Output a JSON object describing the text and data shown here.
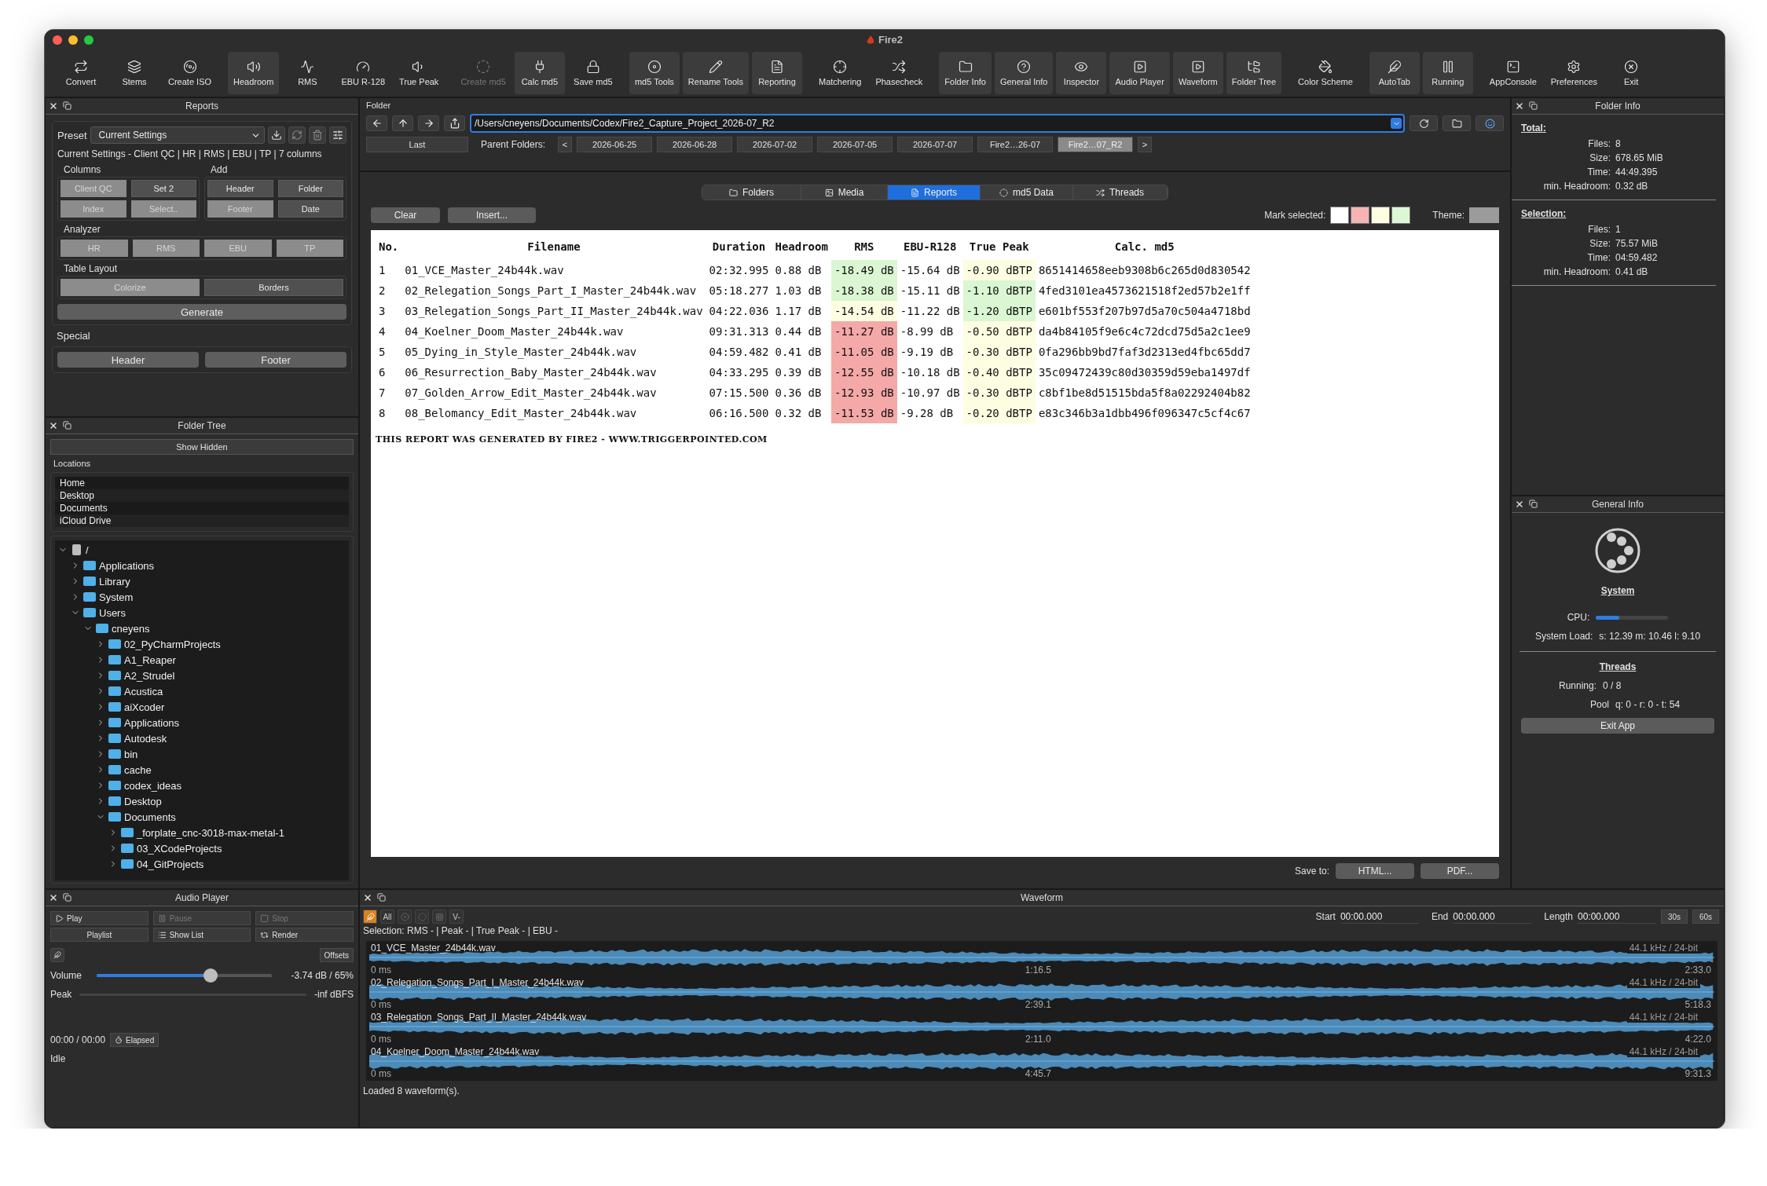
{
  "window": {
    "title": "Fire2"
  },
  "toolbar": [
    {
      "items": [
        {
          "label": "Convert",
          "active": false,
          "disabled": false
        },
        {
          "label": "Stems",
          "active": false,
          "disabled": false
        },
        {
          "label": "Create ISO",
          "active": false,
          "disabled": false
        }
      ]
    },
    {
      "items": [
        {
          "label": "Headroom",
          "active": true,
          "disabled": false
        },
        {
          "label": "RMS",
          "active": false,
          "disabled": false
        },
        {
          "label": "EBU R-128",
          "active": false,
          "disabled": false
        },
        {
          "label": "True Peak",
          "active": false,
          "disabled": false
        }
      ]
    },
    {
      "items": [
        {
          "label": "Create md5",
          "active": false,
          "disabled": true
        },
        {
          "label": "Calc md5",
          "active": true,
          "disabled": false
        },
        {
          "label": "Save md5",
          "active": false,
          "disabled": false
        }
      ]
    },
    {
      "items": [
        {
          "label": "md5 Tools",
          "active": true,
          "disabled": false
        },
        {
          "label": "Rename Tools",
          "active": true,
          "disabled": false
        },
        {
          "label": "Reporting",
          "active": true,
          "disabled": false
        }
      ]
    },
    {
      "items": [
        {
          "label": "Matchering",
          "active": false,
          "disabled": false
        },
        {
          "label": "Phasecheck",
          "active": false,
          "disabled": false
        }
      ]
    },
    {
      "items": [
        {
          "label": "Folder Info",
          "active": true,
          "disabled": false
        },
        {
          "label": "General Info",
          "active": true,
          "disabled": false
        },
        {
          "label": "Inspector",
          "active": true,
          "disabled": false
        },
        {
          "label": "Audio Player",
          "active": true,
          "disabled": false
        },
        {
          "label": "Waveform",
          "active": true,
          "disabled": false
        },
        {
          "label": "Folder Tree",
          "active": true,
          "disabled": false
        }
      ]
    },
    {
      "items": [
        {
          "label": "Color Scheme",
          "active": false,
          "disabled": false
        }
      ]
    },
    {
      "items": [
        {
          "label": "AutoTab",
          "active": true,
          "disabled": false
        },
        {
          "label": "Running",
          "active": true,
          "disabled": false
        }
      ]
    },
    {
      "items": [
        {
          "label": "AppConsole",
          "active": false,
          "disabled": false
        },
        {
          "label": "Preferences",
          "active": false,
          "disabled": false
        },
        {
          "label": "Exit",
          "active": false,
          "disabled": false
        }
      ]
    }
  ],
  "reports": {
    "title": "Reports",
    "preset_label": "Preset",
    "preset": "Current Settings",
    "summary": "Current Settings - Client QC | HR | RMS | EBU | TP | 7 columns",
    "groups": [
      {
        "title": "Columns",
        "kind": "half",
        "buttons": [
          {
            "label": "Client QC",
            "on": true
          },
          {
            "label": "Set 2",
            "on": false
          },
          {
            "label": "Index",
            "on": true
          },
          {
            "label": "Select..",
            "on": true
          }
        ]
      },
      {
        "title": "Add",
        "kind": "half",
        "buttons": [
          {
            "label": "Header",
            "on": false
          },
          {
            "label": "Folder",
            "on": false
          },
          {
            "label": "Footer",
            "on": true
          },
          {
            "label": "Date",
            "on": false
          }
        ]
      },
      {
        "title": "Analyzer",
        "kind": "full",
        "buttons": [
          {
            "label": "HR",
            "on": true
          },
          {
            "label": "RMS",
            "on": true
          },
          {
            "label": "EBU",
            "on": true
          },
          {
            "label": "TP",
            "on": true
          }
        ]
      },
      {
        "title": "Table Layout",
        "kind": "full",
        "buttons": [
          {
            "label": "Colorize",
            "on": true
          },
          {
            "label": "Borders",
            "on": false
          }
        ]
      }
    ],
    "generate": "Generate",
    "special_title": "Special",
    "special_buttons": [
      "Header",
      "Footer"
    ]
  },
  "folder_tree": {
    "title": "Folder Tree",
    "show_hidden": "Show Hidden",
    "locations_label": "Locations",
    "locations": [
      "Home",
      "Desktop",
      "Documents",
      "iCloud Drive"
    ],
    "tree": [
      {
        "label": "/",
        "kind": "drive",
        "expanded": true,
        "children": [
          {
            "label": "Applications",
            "kind": "folder",
            "expanded": false
          },
          {
            "label": "Library",
            "kind": "folder",
            "expanded": false
          },
          {
            "label": "System",
            "kind": "folder",
            "expanded": false
          },
          {
            "label": "Users",
            "kind": "folder",
            "expanded": true,
            "children": [
              {
                "label": "cneyens",
                "kind": "folder",
                "expanded": true,
                "children": [
                  {
                    "label": "02_PyCharmProjects",
                    "kind": "folder",
                    "expanded": false
                  },
                  {
                    "label": "A1_Reaper",
                    "kind": "folder",
                    "expanded": false
                  },
                  {
                    "label": "A2_Strudel",
                    "kind": "folder",
                    "expanded": false
                  },
                  {
                    "label": "Acustica",
                    "kind": "folder",
                    "expanded": false
                  },
                  {
                    "label": "aiXcoder",
                    "kind": "folder",
                    "expanded": false
                  },
                  {
                    "label": "Applications",
                    "kind": "folder",
                    "expanded": false
                  },
                  {
                    "label": "Autodesk",
                    "kind": "folder",
                    "expanded": false
                  },
                  {
                    "label": "bin",
                    "kind": "folder",
                    "expanded": false
                  },
                  {
                    "label": "cache",
                    "kind": "folder",
                    "expanded": false
                  },
                  {
                    "label": "codex_ideas",
                    "kind": "folder",
                    "expanded": false
                  },
                  {
                    "label": "Desktop",
                    "kind": "folder",
                    "expanded": false
                  },
                  {
                    "label": "Documents",
                    "kind": "folder",
                    "expanded": true,
                    "children": [
                      {
                        "label": "_forplate_cnc-3018-max-metal-1",
                        "kind": "folder",
                        "expanded": false
                      },
                      {
                        "label": "03_XCodeProjects",
                        "kind": "folder",
                        "expanded": false
                      },
                      {
                        "label": "04_GitProjects",
                        "kind": "folder",
                        "expanded": false
                      }
                    ]
                  }
                ]
              }
            ]
          }
        ]
      }
    ]
  },
  "audio_player": {
    "title": "Audio Player",
    "buttons": [
      {
        "label": "Play",
        "disabled": false
      },
      {
        "label": "Pause",
        "disabled": true
      },
      {
        "label": "Stop",
        "disabled": true
      },
      {
        "label": "Playlist",
        "disabled": false
      },
      {
        "label": "Show List",
        "disabled": false
      },
      {
        "label": "Render",
        "disabled": false
      }
    ],
    "offsets": "Offsets",
    "volume": {
      "label": "Volume",
      "level": 0.65,
      "reading": "-3.74 dB / 65%"
    },
    "peak": {
      "label": "Peak",
      "reading": "-inf dBFS"
    },
    "time": "00:00 / 00:00",
    "elapsed": "Elapsed",
    "status": "Idle"
  },
  "folder": {
    "title": "Folder",
    "path": "/Users/cneyens/Documents/Codex/Fire2_Capture_Project_2026-07_R2",
    "last": "Last",
    "parent_label": "Parent Folders:",
    "prev": "<",
    "next": ">",
    "crumbs": [
      {
        "label": "2026-06-25",
        "selected": false
      },
      {
        "label": "2026-06-28",
        "selected": false
      },
      {
        "label": "2026-07-02",
        "selected": false
      },
      {
        "label": "2026-07-05",
        "selected": false
      },
      {
        "label": "2026-07-07",
        "selected": false
      },
      {
        "label": "Fire2…26-07",
        "selected": false
      },
      {
        "label": "Fire2…07_R2",
        "selected": true
      }
    ]
  },
  "report_view": {
    "tabs": [
      {
        "label": "Folders",
        "selected": false
      },
      {
        "label": "Media",
        "selected": false
      },
      {
        "label": "Reports",
        "selected": true
      },
      {
        "label": "md5 Data",
        "selected": false
      },
      {
        "label": "Threads",
        "selected": false
      }
    ],
    "buttons": [
      "Clear",
      "Insert..."
    ],
    "mark_label": "Mark selected:",
    "marks": [
      {
        "color": "#ffffff"
      },
      {
        "color": "#f5b3b3"
      },
      {
        "color": "#fdfde2"
      },
      {
        "color": "#dcf7d5"
      }
    ],
    "theme_label": "Theme:",
    "theme": {
      "color": "#9b9b9b"
    },
    "columns": [
      "No.",
      "Filename",
      "Duration",
      "Headroom",
      "RMS",
      "EBU-R128",
      "True Peak",
      "Calc. md5"
    ],
    "rows": [
      {
        "no": "1",
        "filename": "01_VCE_Master_24b44k.wav",
        "duration": "02:32.995",
        "headroom": "0.88 dB",
        "rms": {
          "text": "-18.49 dB",
          "color": "#daf6d2"
        },
        "ebu": "-15.64 dB",
        "tp": {
          "text": "-0.90 dBTP",
          "color": "#fdfde2"
        },
        "md5": "8651414658eeb9308b6c265d0d830542"
      },
      {
        "no": "2",
        "filename": "02_Relegation_Songs_Part_I_Master_24b44k.wav",
        "duration": "05:18.277",
        "headroom": "1.03 dB",
        "rms": {
          "text": "-18.38 dB",
          "color": "#daf6d2"
        },
        "ebu": "-15.11 dB",
        "tp": {
          "text": "-1.10 dBTP",
          "color": "#daf6d2"
        },
        "md5": "4fed3101ea4573621518f2ed57b2e1ff"
      },
      {
        "no": "3",
        "filename": "03_Relegation_Songs_Part_II_Master_24b44k.wav",
        "duration": "04:22.036",
        "headroom": "1.17 dB",
        "rms": {
          "text": "-14.54 dB",
          "color": "#fdfde2"
        },
        "ebu": "-11.22 dB",
        "tp": {
          "text": "-1.20 dBTP",
          "color": "#daf6d2"
        },
        "md5": "e601bf553f207b97d5a70c504a4718bd"
      },
      {
        "no": "4",
        "filename": "04_Koelner_Doom_Master_24b44k.wav",
        "duration": "09:31.313",
        "headroom": "0.44 dB",
        "rms": {
          "text": "-11.27 dB",
          "color": "#f4a9a8"
        },
        "ebu": "-8.99 dB",
        "tp": {
          "text": "-0.50 dBTP",
          "color": "#fdfde2"
        },
        "md5": "da4b84105f9e6c4c72dcd75d5a2c1ee9"
      },
      {
        "no": "5",
        "filename": "05_Dying_in_Style_Master_24b44k.wav",
        "duration": "04:59.482",
        "headroom": "0.41 dB",
        "rms": {
          "text": "-11.05 dB",
          "color": "#f4a9a8"
        },
        "ebu": "-9.19 dB",
        "tp": {
          "text": "-0.30 dBTP",
          "color": "#fdfde2"
        },
        "md5": "0fa296bb9bd7faf3d2313ed4fbc65dd7"
      },
      {
        "no": "6",
        "filename": "06_Resurrection_Baby_Master_24b44k.wav",
        "duration": "04:33.295",
        "headroom": "0.39 dB",
        "rms": {
          "text": "-12.55 dB",
          "color": "#f4a9a8"
        },
        "ebu": "-10.18 dB",
        "tp": {
          "text": "-0.40 dBTP",
          "color": "#fdfde2"
        },
        "md5": "35c09472439c80d30359d59eba1497df"
      },
      {
        "no": "7",
        "filename": "07_Golden_Arrow_Edit_Master_24b44k.wav",
        "duration": "07:15.500",
        "headroom": "0.36 dB",
        "rms": {
          "text": "-12.93 dB",
          "color": "#f4a9a8"
        },
        "ebu": "-10.97 dB",
        "tp": {
          "text": "-0.30 dBTP",
          "color": "#fdfde2"
        },
        "md5": "c8bf1be8d51515bda5f8a02292404b82"
      },
      {
        "no": "8",
        "filename": "08_Belomancy_Edit_Master_24b44k.wav",
        "duration": "06:16.500",
        "headroom": "0.32 dB",
        "rms": {
          "text": "-11.53 dB",
          "color": "#f4a9a8"
        },
        "ebu": "-9.28 dB",
        "tp": {
          "text": "-0.20 dBTP",
          "color": "#fdfde2"
        },
        "md5": "e83c346b3a1dbb496f096347c5cf4c67"
      }
    ],
    "footer": "THIS REPORT WAS GENERATED BY FIRE2 - WWW.TRIGGERPOINTED.COM",
    "save_label": "Save to:",
    "save_buttons": [
      "HTML...",
      "PDF..."
    ]
  },
  "folder_info": {
    "title": "Folder Info",
    "sections": [
      {
        "heading": "Total:",
        "rows": [
          {
            "label": "Files:",
            "value": "8"
          },
          {
            "label": "Size:",
            "value": "678.65 MiB"
          },
          {
            "label": "Time:",
            "value": "44:49.395"
          },
          {
            "label": "min. Headroom:",
            "value": "0.32 dB"
          }
        ]
      },
      {
        "heading": "Selection:",
        "rows": [
          {
            "label": "Files:",
            "value": "1"
          },
          {
            "label": "Size:",
            "value": "75.57 MiB"
          },
          {
            "label": "Time:",
            "value": "04:59.482"
          },
          {
            "label": "min. Headroom:",
            "value": "0.41 dB"
          }
        ]
      }
    ]
  },
  "general_info": {
    "title": "General Info",
    "system_heading": "System",
    "cpu": {
      "label": "CPU:",
      "level": 0.32
    },
    "load": {
      "label": "System Load:",
      "value": "s: 12.39 m: 10.46 l: 9.10"
    },
    "threads_heading": "Threads",
    "running": {
      "label": "Running:",
      "value": "0 / 8"
    },
    "pool": {
      "label": "Pool",
      "value": "q: 0 - r: 0 - t: 54"
    },
    "exit": "Exit App"
  },
  "waveform": {
    "title": "Waveform",
    "tools": [
      {
        "kind": "icon",
        "active": true
      },
      {
        "kind": "text",
        "label": "All",
        "active": false
      },
      {
        "kind": "icon",
        "active": false
      },
      {
        "kind": "icon",
        "active": false
      },
      {
        "kind": "icon",
        "active": false
      },
      {
        "kind": "text",
        "label": "V-",
        "active": false
      }
    ],
    "fields": [
      {
        "label": "Start",
        "value": "00:00.000"
      },
      {
        "label": "End",
        "value": "00:00.000"
      },
      {
        "label": "Length",
        "value": "00:00.000"
      }
    ],
    "spans": [
      "30s",
      "60s"
    ],
    "selection": "Selection: RMS - | Peak - | True Peak - | EBU -",
    "tracks": [
      {
        "name": "01_VCE_Master_24b44k.wav",
        "start": "0 ms",
        "mid": "1:16.5",
        "end": "2:33.0",
        "format": "44.1 kHz / 24-bit"
      },
      {
        "name": "02_Relegation_Songs_Part_I_Master_24b44k.wav",
        "start": "0 ms",
        "mid": "2:39.1",
        "end": "5:18.3",
        "format": "44.1 kHz / 24-bit"
      },
      {
        "name": "03_Relegation_Songs_Part_II_Master_24b44k.wav",
        "start": "0 ms",
        "mid": "2:11.0",
        "end": "4:22.0",
        "format": "44.1 kHz / 24-bit"
      },
      {
        "name": "04_Koelner_Doom_Master_24b44k.wav",
        "start": "0 ms",
        "mid": "4:45.7",
        "end": "9:31.3",
        "format": "44.1 kHz / 24-bit"
      }
    ],
    "status": "Loaded 8 waveform(s)."
  }
}
